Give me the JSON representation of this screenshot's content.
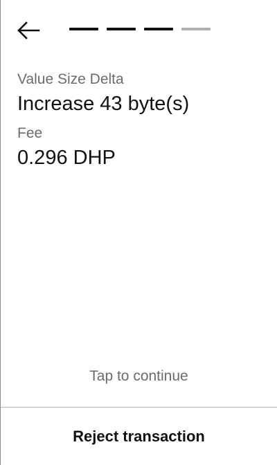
{
  "header": {
    "back_icon": "arrow-left-icon",
    "progress": {
      "total_steps": 4,
      "completed_steps": 3,
      "active_color": "#111111",
      "inactive_color": "#b0b0b0"
    }
  },
  "details": {
    "items": [
      {
        "label": "Value Size Delta",
        "value": "Increase 43 byte(s)"
      },
      {
        "label": "Fee",
        "value": "0.296 DHP"
      }
    ]
  },
  "footer": {
    "tap_hint": "Tap to continue",
    "reject_label": "Reject transaction"
  }
}
